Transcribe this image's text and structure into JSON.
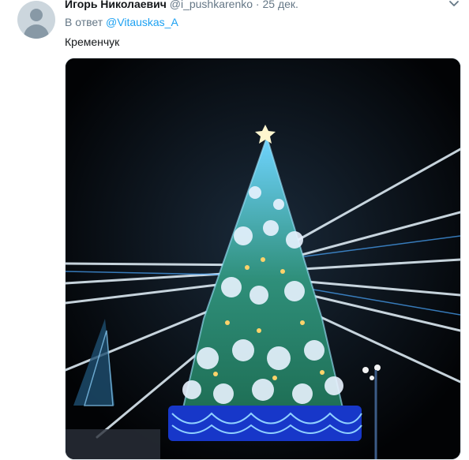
{
  "tweet": {
    "author_name": "Игорь Николаевич",
    "author_handle": "@i_pushkarenko",
    "separator": "·",
    "date": "25 дек.",
    "reply_prefix": "В ответ",
    "reply_mention": "@Vitauskas_A",
    "text": "Кременчук",
    "avatar_icon": "default-profile-icon",
    "menu_icon": "chevron-down-icon",
    "photo_subject": "illuminated-christmas-tree-at-night"
  },
  "colors": {
    "name": "#14171a",
    "secondary": "#657786",
    "link": "#1da1f2",
    "avatar_bg": "#ccd6dd"
  }
}
